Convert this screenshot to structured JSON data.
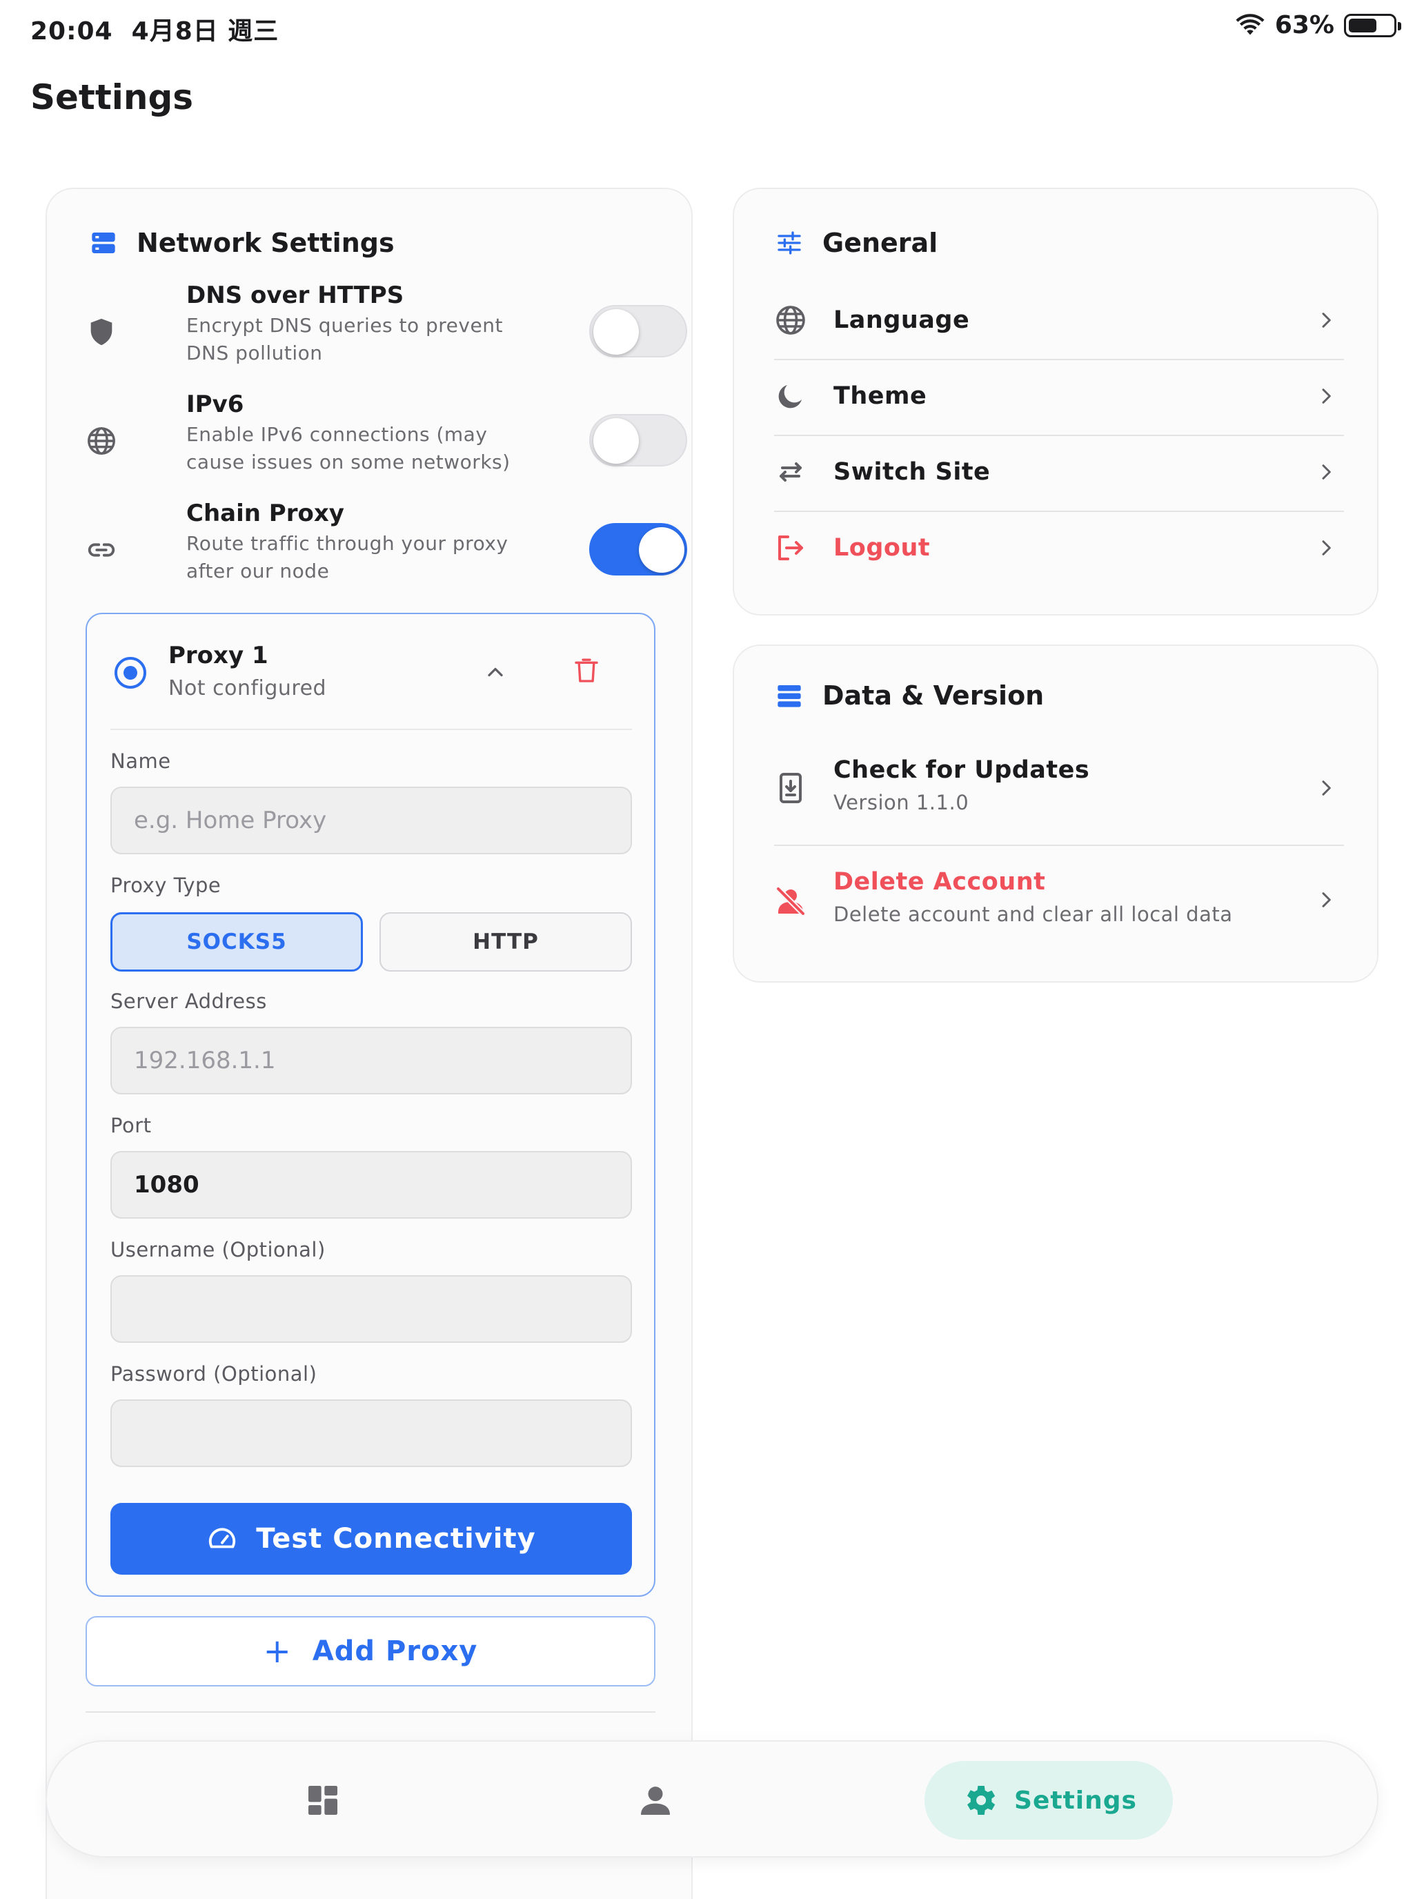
{
  "status_bar": {
    "time": "20:04",
    "date": "4月8日 週三",
    "battery": "63%",
    "battery_level": 0.63
  },
  "page_title": "Settings",
  "network": {
    "title": "Network Settings",
    "toggles": [
      {
        "title": "DNS over HTTPS",
        "desc_line1": "Encrypt DNS queries to prevent",
        "desc_line2": "DNS pollution",
        "on": false,
        "icon": "shield-icon"
      },
      {
        "title": "IPv6",
        "desc_line1": "Enable IPv6 connections (may",
        "desc_line2": "cause issues on some networks)",
        "on": false,
        "icon": "globe-icon"
      },
      {
        "title": "Chain Proxy",
        "desc_line1": "Route traffic through your proxy",
        "desc_line2": "after our node",
        "on": true,
        "icon": "link-icon"
      }
    ],
    "proxy": {
      "name": "Proxy 1",
      "status": "Not configured",
      "name_label": "Name",
      "name_placeholder": "e.g. Home Proxy",
      "type_label": "Proxy Type",
      "type_options": [
        "SOCKS5",
        "HTTP"
      ],
      "type_selected": "SOCKS5",
      "server_label": "Server Address",
      "server_placeholder": "192.168.1.1",
      "port_label": "Port",
      "port_value": "1080",
      "username_label": "Username (Optional)",
      "username_value": "",
      "password_label": "Password (Optional)",
      "password_value": "",
      "test_button": "Test Connectivity"
    },
    "add_proxy": "Add Proxy"
  },
  "general": {
    "title": "General",
    "items": [
      {
        "label": "Language",
        "icon": "globe-icon"
      },
      {
        "label": "Theme",
        "icon": "moon-icon"
      },
      {
        "label": "Switch Site",
        "icon": "swap-icon"
      },
      {
        "label": "Logout",
        "icon": "logout-icon",
        "danger": true
      }
    ]
  },
  "data_version": {
    "title": "Data & Version",
    "items": [
      {
        "label": "Check for Updates",
        "sub": "Version 1.1.0",
        "icon": "update-icon"
      },
      {
        "label": "Delete Account",
        "sub": "Delete account and clear all local data",
        "icon": "delete-account-icon",
        "danger": true
      }
    ]
  },
  "bottom_nav": {
    "items": [
      {
        "icon": "dashboard-icon"
      },
      {
        "icon": "account-icon"
      },
      {
        "label": "Settings",
        "icon": "gear-icon",
        "active": true
      }
    ]
  },
  "colors": {
    "accent": "#2b6ff0",
    "danger": "#f0505a",
    "active_nav": "#1aa890"
  }
}
